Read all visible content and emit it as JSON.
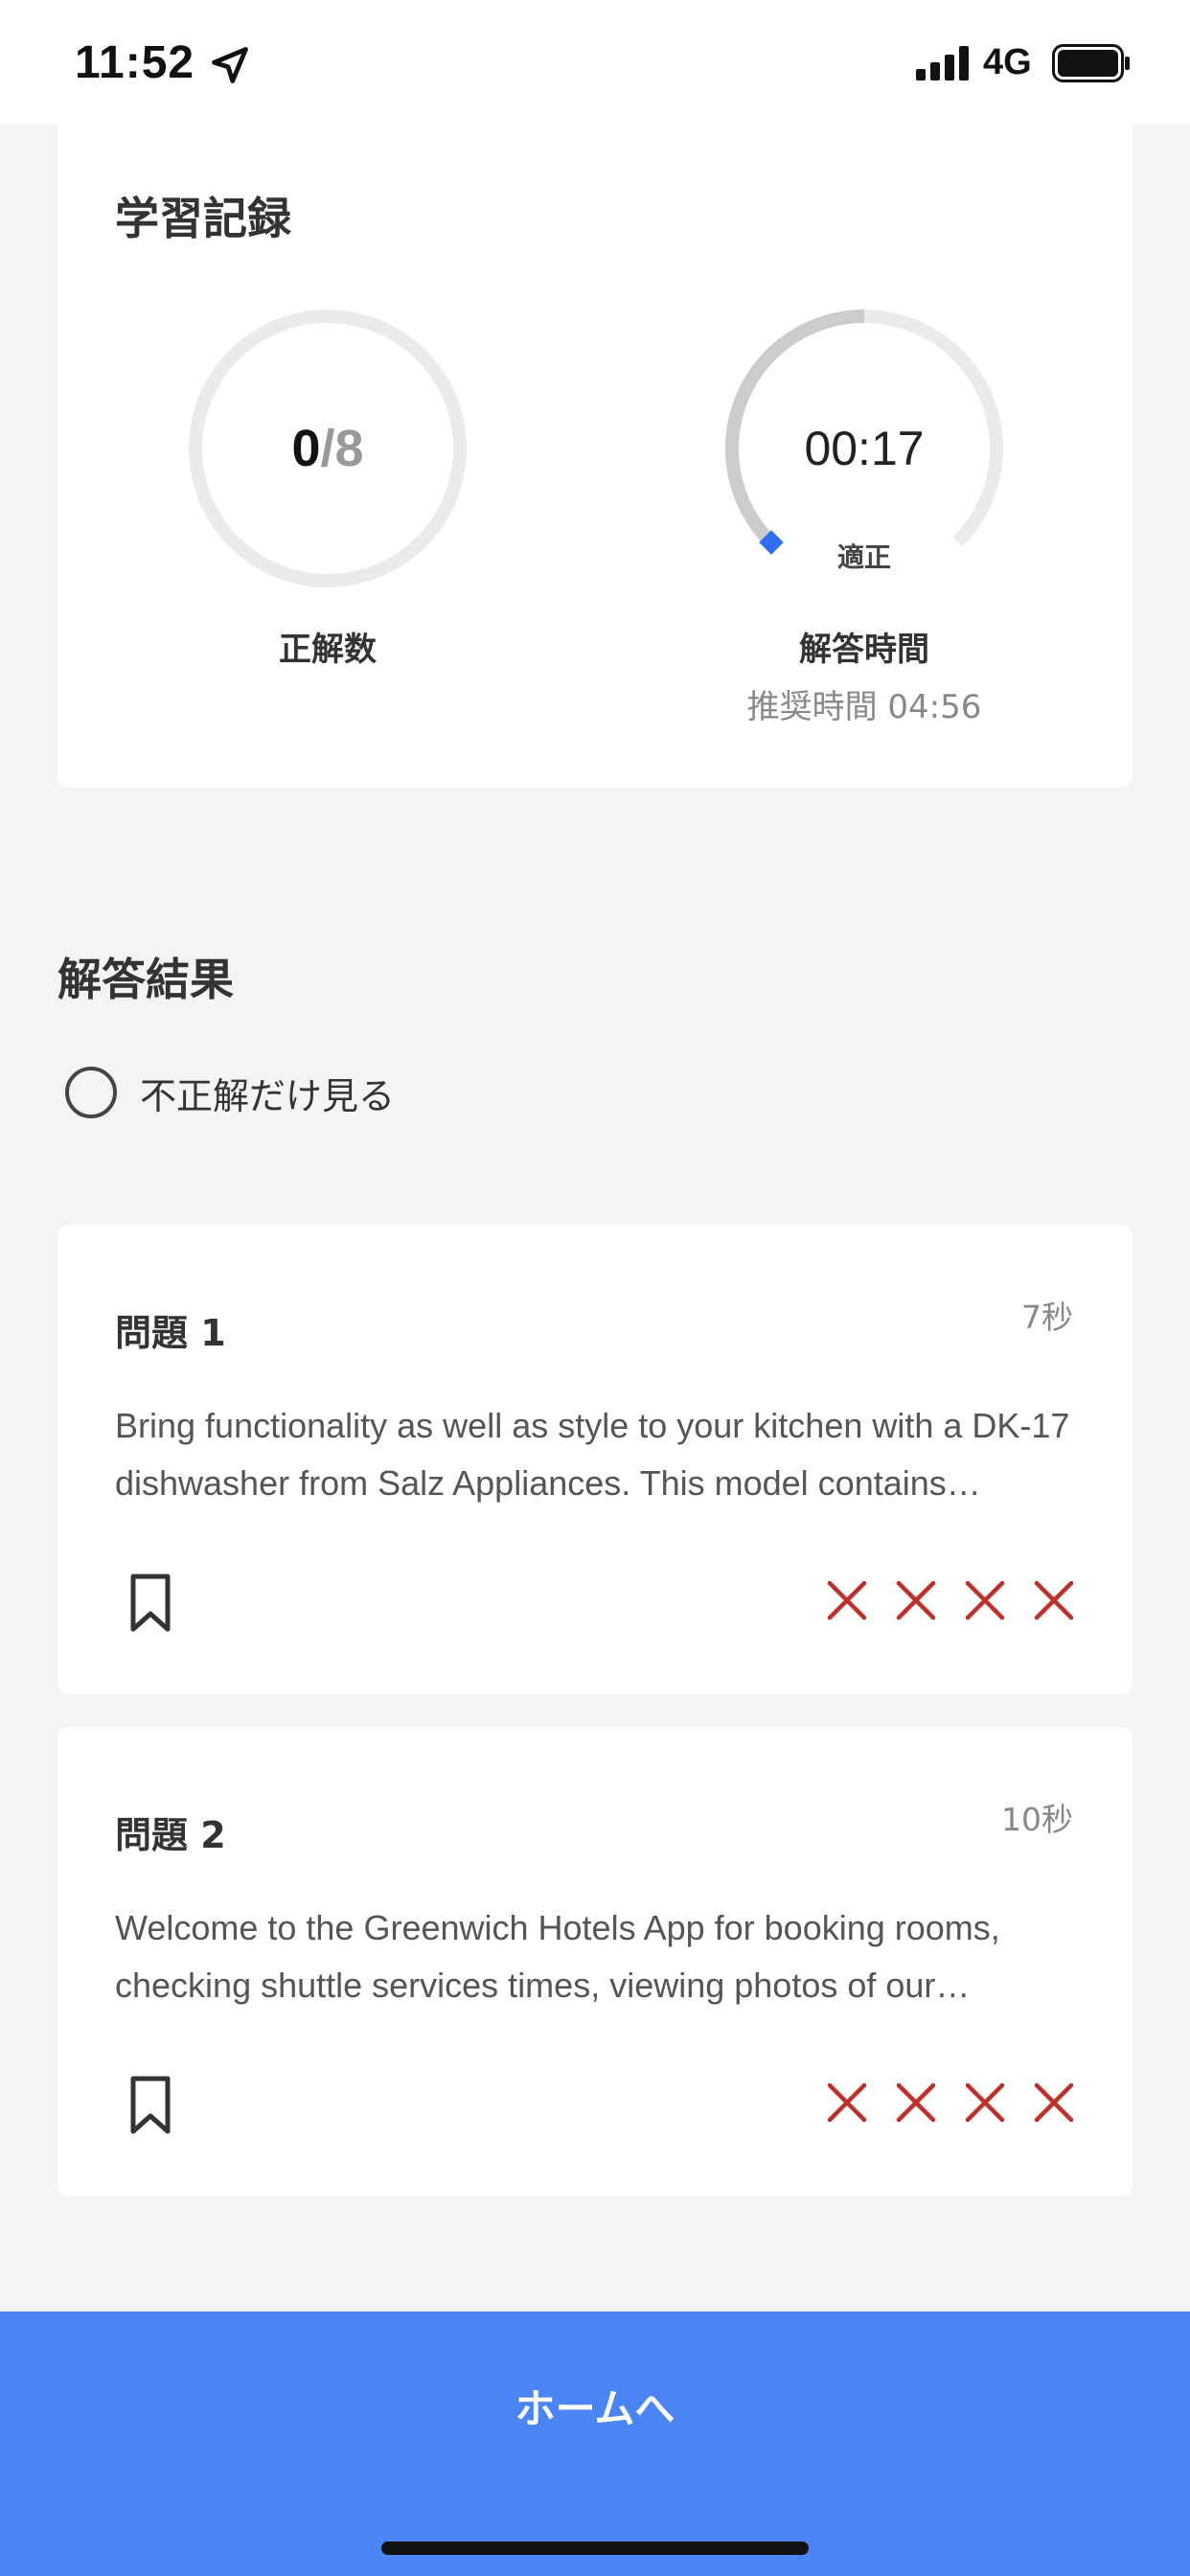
{
  "status_bar": {
    "time": "11:52",
    "network": "4G",
    "icons": [
      "location-arrow-icon",
      "signal-icon",
      "battery-icon"
    ]
  },
  "stats": {
    "title": "学習記録",
    "correct": {
      "score": "0",
      "slash": "/",
      "total": "8",
      "label": "正解数",
      "progress_fraction": 0.0
    },
    "time": {
      "value": "00:17",
      "status": "適正",
      "label": "解答時間",
      "recommended": "推奨時間 04:56"
    }
  },
  "results": {
    "title": "解答結果",
    "filter_label": "不正解だけ見る",
    "filter_checked": false
  },
  "questions": [
    {
      "title": "問題 1",
      "time": "7秒",
      "text": "Bring functionality as well as style to your kitchen with a DK-17 dishwasher from Salz Appliances. This model contains…",
      "marks": [
        "wrong",
        "wrong",
        "wrong",
        "wrong"
      ]
    },
    {
      "title": "問題 2",
      "time": "10秒",
      "text": "Welcome to the Greenwich Hotels App for booking rooms, checking shuttle services times, viewing photos of our…",
      "marks": [
        "wrong",
        "wrong",
        "wrong",
        "wrong"
      ]
    }
  ],
  "footer": {
    "home_label": "ホームへ"
  },
  "colors": {
    "accent_blue": "#4a84f5",
    "wrong_red": "#c0302a",
    "ring_track": "#ebebeb",
    "ring_time_progress": "#cccccc",
    "ring_time_marker": "#2d6ff0"
  }
}
